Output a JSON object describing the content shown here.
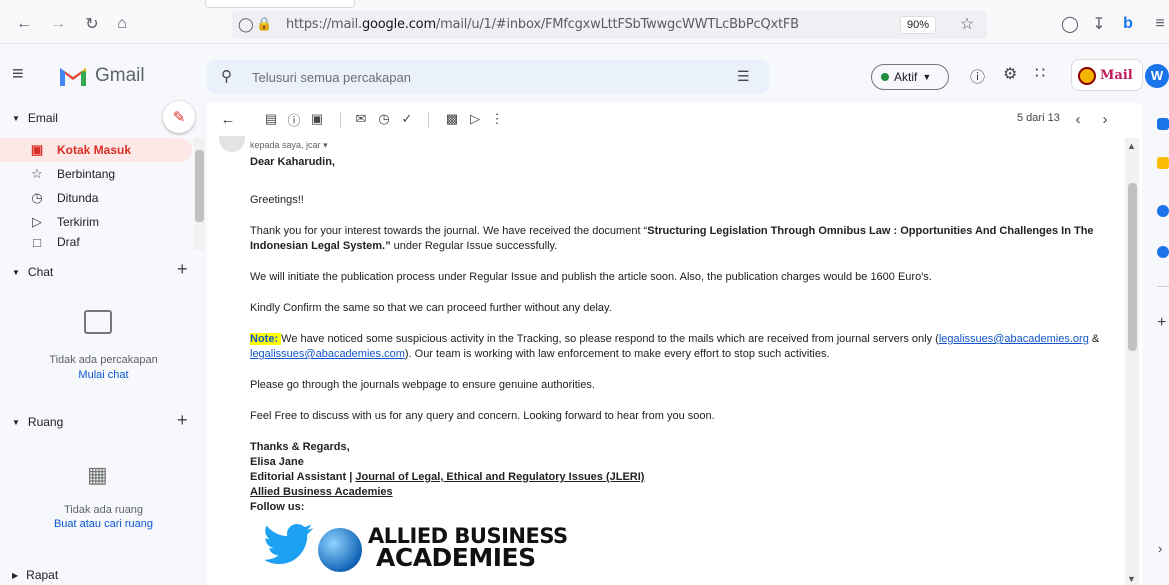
{
  "browser": {
    "url_prefix": "https://mail.",
    "url_domain": "google.com",
    "url_suffix": "/mail/u/1/#inbox/FMfcgxwLttFSbTwwgcWWTLcBbPcQxtFB",
    "zoom": "90%"
  },
  "gmail": {
    "brand": "Gmail",
    "search_placeholder": "Telusuri semua percakapan",
    "status": "Aktif",
    "avatar_letter": "W",
    "badge_text": "Mail"
  },
  "sidebar": {
    "email_section": "Email",
    "items": [
      {
        "label": "Kotak Masuk",
        "icon": "inbox-icon"
      },
      {
        "label": "Berbintang",
        "icon": "star-icon"
      },
      {
        "label": "Ditunda",
        "icon": "clock-icon"
      },
      {
        "label": "Terkirim",
        "icon": "send-icon"
      },
      {
        "label": "Draf",
        "icon": "draft-icon"
      }
    ],
    "chat_section": "Chat",
    "chat_empty": "Tidak ada percakapan",
    "chat_start": "Mulai chat",
    "rooms_section": "Ruang",
    "rooms_empty": "Tidak ada ruang",
    "rooms_find": "Buat atau cari ruang",
    "meet_section": "Rapat"
  },
  "toolbar": {
    "page_count": "5 dari 13"
  },
  "email": {
    "to_line": "kepada saya, jcar",
    "salutation": "Dear Kaharudin,",
    "greeting": "Greetings!!",
    "p1_a": "Thank you for your interest towards the journal. We have received the document “",
    "p1_bold": "Structuring Legislation Through Omnibus Law : Opportunities And Challenges In The Indonesian Legal System.”",
    "p1_b": " under Regular Issue successfully.",
    "p2": "We will initiate the publication process under Regular Issue and publish the article soon. Also, the publication charges would be 1600 Euro's.",
    "p3": "Kindly Confirm the same so that we can proceed further without any delay.",
    "note_label": "Note: ",
    "note_a": " We have noticed some suspicious activity in the Tracking, so please respond to the mails which are received from journal servers only (",
    "note_link1": "legalissues@abacademies.org",
    "note_amp": " &",
    "note_link2": "legalissues@abacademies.com",
    "note_b": "). Our team is working with law enforcement to make every effort to stop such activities.",
    "p4": "Please go through the journals webpage to ensure genuine authorities.",
    "p5": "Feel Free to discuss with us for any query and concern. Looking forward to hear from you soon.",
    "sign1": "Thanks & Regards,",
    "sign2": "Elisa Jane",
    "sign3_a": "Editorial Assistant | ",
    "sign3_link": "Journal of Legal, Ethical and Regulatory Issues (JLERI)",
    "sign4": "Allied Business Academies",
    "sign5": "Follow us:",
    "logo_line1": "ALLIED BUSINESS",
    "logo_line2": "ACADEMIES"
  },
  "colors": {
    "accent_red": "#d93025",
    "link_blue": "#1155cc",
    "twitter_blue": "#1da1f2",
    "status_green": "#1e8e3e"
  }
}
